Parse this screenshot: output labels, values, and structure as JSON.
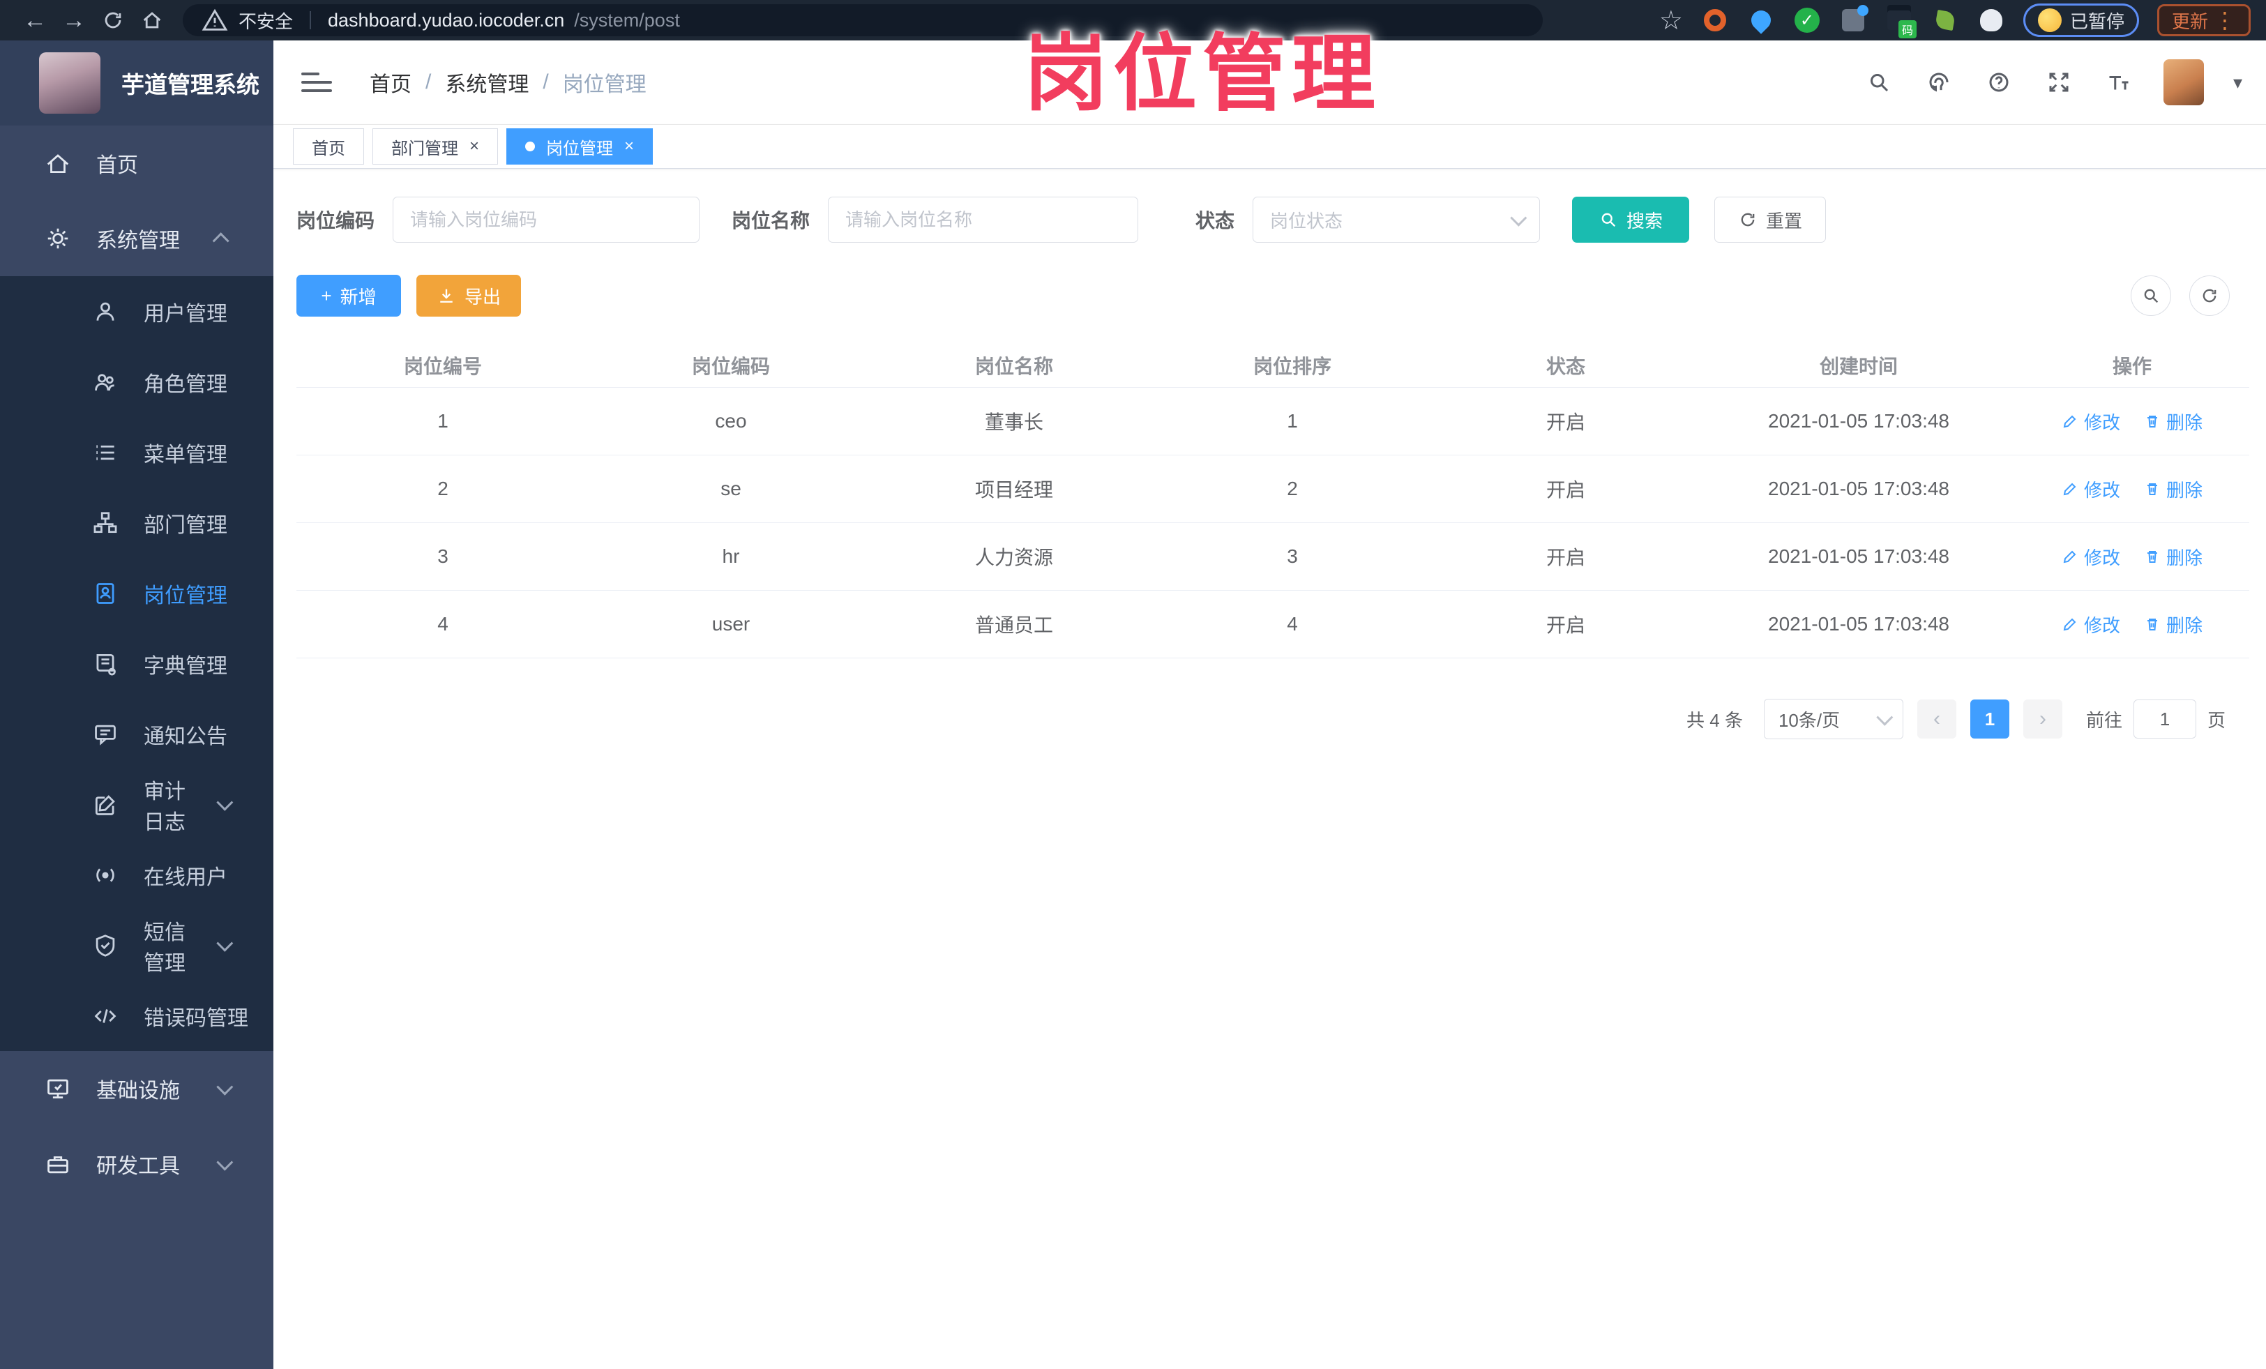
{
  "browser": {
    "security_label": "不安全",
    "url_host": "dashboard.yudao.iocoder.cn",
    "url_path": "/system/post",
    "paused_label": "已暂停",
    "update_label": "更新"
  },
  "overlay": {
    "title": "岗位管理"
  },
  "sidebar": {
    "logo_text": "芋道管理系统",
    "items": [
      {
        "label": "首页",
        "icon": "home-icon",
        "level": 0
      },
      {
        "label": "系统管理",
        "icon": "gear-icon",
        "level": 0,
        "state": "expanded"
      },
      {
        "label": "用户管理",
        "icon": "user-icon",
        "level": 1
      },
      {
        "label": "角色管理",
        "icon": "users-icon",
        "level": 1
      },
      {
        "label": "菜单管理",
        "icon": "menu-list-icon",
        "level": 1
      },
      {
        "label": "部门管理",
        "icon": "org-tree-icon",
        "level": 1
      },
      {
        "label": "岗位管理",
        "icon": "id-badge-icon",
        "level": 1,
        "active": true
      },
      {
        "label": "字典管理",
        "icon": "dictionary-icon",
        "level": 1
      },
      {
        "label": "通知公告",
        "icon": "announcement-icon",
        "level": 1
      },
      {
        "label": "审计日志",
        "icon": "audit-log-icon",
        "level": 1,
        "state": "collapsed"
      },
      {
        "label": "在线用户",
        "icon": "online-users-icon",
        "level": 1
      },
      {
        "label": "短信管理",
        "icon": "sms-shield-icon",
        "level": 1,
        "state": "collapsed"
      },
      {
        "label": "错误码管理",
        "icon": "error-code-icon",
        "level": 1
      },
      {
        "label": "基础设施",
        "icon": "infrastructure-icon",
        "level": 0,
        "state": "collapsed"
      },
      {
        "label": "研发工具",
        "icon": "devtools-icon",
        "level": 0,
        "state": "collapsed"
      }
    ]
  },
  "breadcrumb": {
    "home": "首页",
    "section": "系统管理",
    "current": "岗位管理",
    "separator": "/"
  },
  "tabs": [
    {
      "label": "首页",
      "closable": false,
      "active": false
    },
    {
      "label": "部门管理",
      "closable": true,
      "active": false
    },
    {
      "label": "岗位管理",
      "closable": true,
      "active": true
    }
  ],
  "filters": {
    "code_label": "岗位编码",
    "code_placeholder": "请输入岗位编码",
    "name_label": "岗位名称",
    "name_placeholder": "请输入岗位名称",
    "status_label": "状态",
    "status_placeholder": "岗位状态",
    "search_label": "搜索",
    "reset_label": "重置"
  },
  "toolbar": {
    "add_label": "新增",
    "export_label": "导出"
  },
  "table": {
    "columns": [
      "岗位编号",
      "岗位编码",
      "岗位名称",
      "岗位排序",
      "状态",
      "创建时间",
      "操作"
    ],
    "rows": [
      {
        "no": "1",
        "code": "ceo",
        "name": "董事长",
        "sort": "1",
        "status": "开启",
        "created": "2021-01-05 17:03:48"
      },
      {
        "no": "2",
        "code": "se",
        "name": "项目经理",
        "sort": "2",
        "status": "开启",
        "created": "2021-01-05 17:03:48"
      },
      {
        "no": "3",
        "code": "hr",
        "name": "人力资源",
        "sort": "3",
        "status": "开启",
        "created": "2021-01-05 17:03:48"
      },
      {
        "no": "4",
        "code": "user",
        "name": "普通员工",
        "sort": "4",
        "status": "开启",
        "created": "2021-01-05 17:03:48"
      }
    ],
    "actions": {
      "edit": "修改",
      "delete": "删除"
    }
  },
  "pagination": {
    "total": "共 4 条",
    "page_size": "10条/页",
    "current": "1",
    "goto_label": "前往",
    "goto_value": "1",
    "page_unit": "页"
  },
  "colors": {
    "primary": "#409EFF",
    "search_teal": "#1abcb0",
    "export_orange": "#f2a43a",
    "overlay_pink": "#f23d5e",
    "sidebar_bg": "#3a4763",
    "submenu_bg": "#1f2d42"
  },
  "icons": {
    "browser": [
      "back-icon",
      "forward-icon",
      "reload-icon",
      "home-icon",
      "warning-icon",
      "bookmark-star-icon",
      "extensions",
      "paused-badge",
      "update-button",
      "kebab-menu-icon"
    ],
    "header": [
      "search-icon",
      "github-icon",
      "help-icon",
      "fullscreen-icon",
      "font-size-icon",
      "avatar",
      "chevron-down-icon"
    ]
  }
}
